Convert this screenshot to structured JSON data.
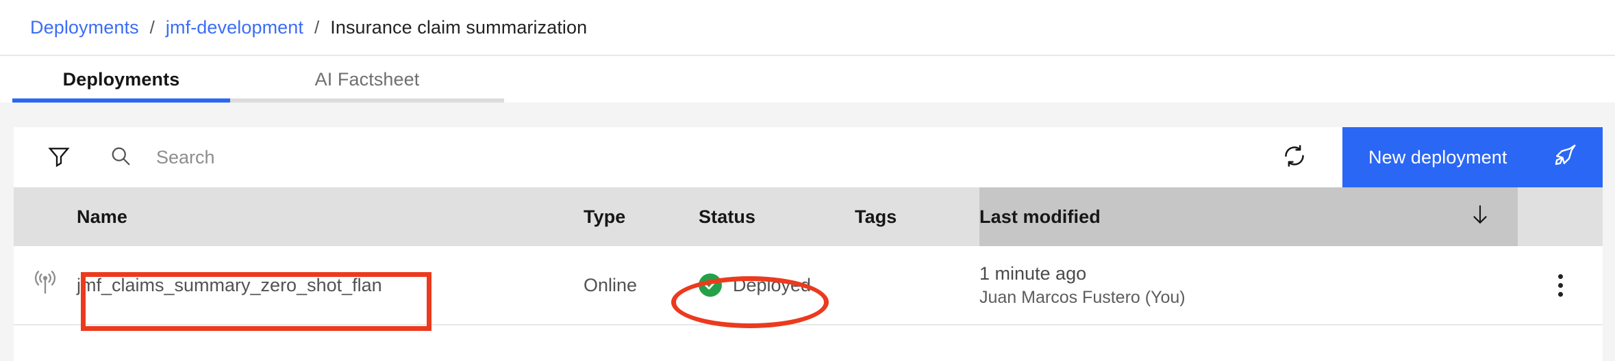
{
  "breadcrumb": {
    "items": [
      {
        "label": "Deployments",
        "link": true
      },
      {
        "label": "jmf-development",
        "link": true
      },
      {
        "label": "Insurance claim summarization",
        "link": false
      }
    ],
    "separator": "/"
  },
  "tabs": [
    {
      "label": "Deployments",
      "active": true
    },
    {
      "label": "AI Factsheet",
      "active": false
    }
  ],
  "toolbar": {
    "filter_icon": "filter-icon",
    "search_icon": "search-icon",
    "search_placeholder": "Search",
    "search_value": "",
    "refresh_icon": "refresh-icon",
    "new_deployment_label": "New deployment",
    "new_deployment_icon": "rocket-icon",
    "accent_color": "#2a67f4"
  },
  "table": {
    "columns": [
      {
        "key": "icon",
        "label": ""
      },
      {
        "key": "name",
        "label": "Name"
      },
      {
        "key": "type",
        "label": "Type"
      },
      {
        "key": "status",
        "label": "Status"
      },
      {
        "key": "tags",
        "label": "Tags"
      },
      {
        "key": "modified",
        "label": "Last modified",
        "sorted": true,
        "sort_icon": "arrow-down-icon"
      },
      {
        "key": "menu",
        "label": ""
      }
    ],
    "rows": [
      {
        "icon": "broadcast-icon",
        "name": "jmf_claims_summary_zero_shot_flan",
        "type": "Online",
        "status": "Deployed",
        "status_icon": "check-circle-icon",
        "status_color": "#24a148",
        "tags": "",
        "modified_time": "1 minute ago",
        "modified_by": "Juan Marcos Fustero (You)",
        "menu_icon": "overflow-menu-icon"
      }
    ]
  },
  "annotations": {
    "color": "#eb3a1e",
    "name_highlight": "rectangle-around-deployment-name",
    "status_highlight": "ellipse-around-deployed-status"
  }
}
